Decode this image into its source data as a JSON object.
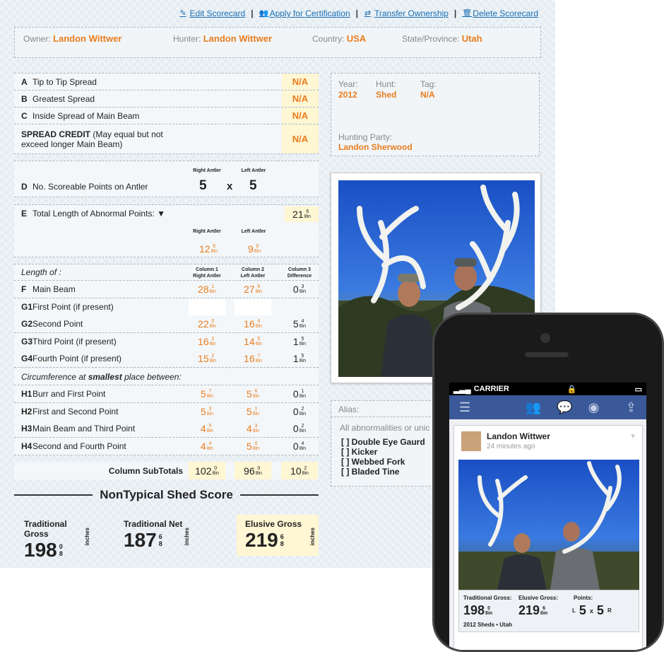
{
  "actions": [
    {
      "icon": "edit-icon",
      "label": "Edit Scorecard"
    },
    {
      "icon": "users-icon",
      "label": "Apply for Certification"
    },
    {
      "icon": "transfer-icon",
      "label": "Transfer Ownership"
    },
    {
      "icon": "trash-icon",
      "label": "Delete Scorecard"
    }
  ],
  "info": {
    "owner_label": "Owner:",
    "owner": "Landon Wittwer",
    "hunter_label": "Hunter:",
    "hunter": "Landon Wittwer",
    "country_label": "Country:",
    "country": "USA",
    "state_label": "State/Province:",
    "state": "Utah"
  },
  "spread": [
    {
      "code": "A",
      "label": "Tip to Tip Spread",
      "value": "N/A"
    },
    {
      "code": "B",
      "label": "Greatest Spread",
      "value": "N/A"
    },
    {
      "code": "C",
      "label": "Inside Spread of Main Beam",
      "value": "N/A"
    }
  ],
  "spread_credit": {
    "label": "SPREAD CREDIT",
    "note": "(May equal but not exceed longer Main Beam)",
    "value": "N/A"
  },
  "points": {
    "code": "D",
    "label": "No. Scoreable Points on Antler",
    "right_header": "Right Antler",
    "left_header": "Left Antler",
    "right": "5",
    "x": "x",
    "left": "5"
  },
  "abnormal": {
    "code": "E",
    "label": "Total Length of Abnormal Points:",
    "total": "21",
    "total_num": "6",
    "total_den": "8in",
    "right_header": "Right Antler",
    "left_header": "Left Antler",
    "right": "12",
    "right_num": "6",
    "right_den": "8in",
    "left": "9",
    "left_num": "0",
    "left_den": "8in"
  },
  "length_header": {
    "label": "Length of :",
    "col1": "Column 1",
    "col1b": "Right Antler",
    "col2": "Column 2",
    "col2b": "Left Antler",
    "col3": "Column 3",
    "col3b": "Difference"
  },
  "length_rows": [
    {
      "code": "F",
      "label": "Main Beam",
      "c1": "28",
      "c1n": "1",
      "c2": "27",
      "c2n": "6",
      "c3": "0",
      "c3n": "3"
    },
    {
      "code": "G1",
      "label": "First Point (if present)",
      "c1": "",
      "c1n": "",
      "c2": "",
      "c2n": "",
      "c3": "",
      "c3n": ""
    },
    {
      "code": "G2",
      "label": "Second Point",
      "c1": "22",
      "c1n": "0",
      "c2": "16",
      "c2n": "4",
      "c3": "5",
      "c3n": "4"
    },
    {
      "code": "G3",
      "label": "Third Point (if present)",
      "c1": "16",
      "c1n": "2",
      "c2": "14",
      "c2n": "5",
      "c3": "1",
      "c3n": "5"
    },
    {
      "code": "G4",
      "label": "Fourth Point (if present)",
      "c1": "15",
      "c1n": "2",
      "c2": "16",
      "c2n": "7",
      "c3": "1",
      "c3n": "5"
    }
  ],
  "circ_header": {
    "pre": "Circumference at ",
    "bold": "smallest",
    "post": " place between:"
  },
  "circ_rows": [
    {
      "code": "H1",
      "label": "Burr and First Point",
      "c1": "5",
      "c1n": "7",
      "c2": "5",
      "c2n": "6",
      "c3": "0",
      "c3n": "1"
    },
    {
      "code": "H2",
      "label": "First and Second Point",
      "c1": "5",
      "c1n": "3",
      "c2": "5",
      "c2n": "1",
      "c3": "0",
      "c3n": "2"
    },
    {
      "code": "H3",
      "label": "Main Beam and Third Point",
      "c1": "4",
      "c1n": "5",
      "c2": "4",
      "c2n": "3",
      "c3": "0",
      "c3n": "2"
    },
    {
      "code": "H4",
      "label": "Second and Fourth Point",
      "c1": "4",
      "c1n": "4",
      "c2": "5",
      "c2n": "0",
      "c3": "0",
      "c3n": "4"
    }
  ],
  "frac_den": "8in",
  "subtotals": {
    "label": "Column SubTotals",
    "c1": "102",
    "c1n": "0",
    "c2": "96",
    "c2n": "0",
    "c3": "10",
    "c3n": "2"
  },
  "score_title": "NonTypical Shed Score",
  "totals": [
    {
      "label": "Traditional Gross",
      "value": "198",
      "num": "0",
      "den": "8",
      "unit": "inches"
    },
    {
      "label": "Traditional Net",
      "value": "187",
      "num": "6",
      "den": "8",
      "unit": "inches"
    },
    {
      "label": "Elusive Gross",
      "value": "219",
      "num": "6",
      "den": "8",
      "unit": "inches"
    }
  ],
  "hunt": {
    "year_label": "Year:",
    "year": "2012",
    "hunt_label": "Hunt:",
    "hunt": "Shed",
    "tag_label": "Tag:",
    "tag": "N/A",
    "party_label": "Hunting Party:",
    "party": "Landon Sherwood"
  },
  "alias": {
    "label": "Alias:"
  },
  "abnormalities": {
    "intro": "All abnormalities or unic",
    "items": [
      "[ ] Double Eye Gaurd",
      "[ ] Kicker",
      "[ ] Webbed Fork",
      "[ ] Bladed Tine"
    ]
  },
  "phone": {
    "carrier": "CARRIER",
    "user": "Landon Wittwer",
    "time": "24 minutes ago",
    "tg_label": "Traditional Gross:",
    "tg": "198",
    "tg_num": "0",
    "eg_label": "Elusive Gross:",
    "eg": "219",
    "eg_num": "6",
    "pts_label": "Points:",
    "pts_l": "L",
    "pts_left": "5",
    "pts_x": "x",
    "pts_right": "5",
    "pts_r": "R",
    "frac_den": "8in",
    "footer": "2012 Sheds • Utah"
  },
  "colors": {
    "accent": "#e87d1e",
    "link": "#1a6fb5",
    "highlight": "#fff6d3",
    "facebook": "#3b5998"
  }
}
